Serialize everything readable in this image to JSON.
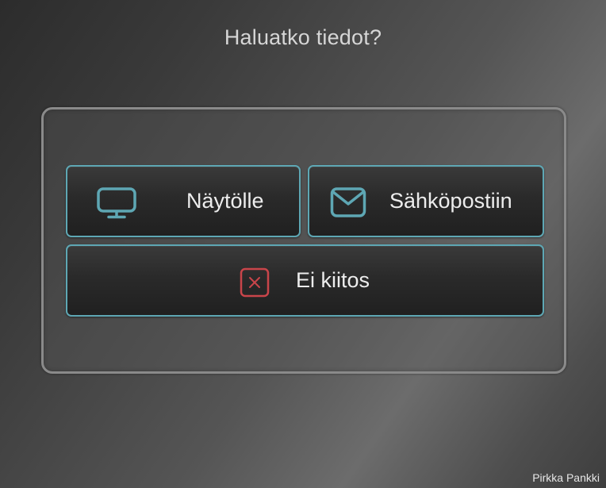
{
  "dialog": {
    "title": "Haluatko tiedot?"
  },
  "options": {
    "screen": {
      "label": "Näytölle",
      "icon": "monitor-icon"
    },
    "email": {
      "label": "Sähköpostiin",
      "icon": "mail-icon"
    },
    "cancel": {
      "label": "Ei kiitos",
      "icon": "close-icon"
    }
  },
  "footer": {
    "brand": "Pirkka Pankki"
  },
  "colors": {
    "accent": "#5ea7b4",
    "cancel_icon": "#c9454a"
  }
}
